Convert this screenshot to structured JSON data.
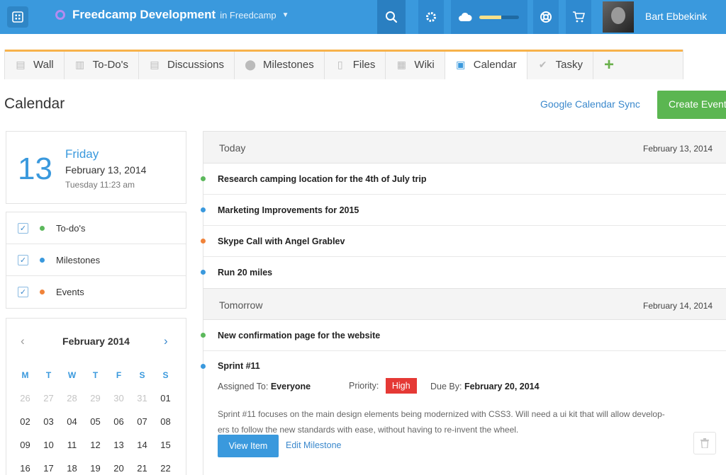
{
  "header": {
    "project_name": "Freedcamp Development",
    "project_sub": "in Freedcamp",
    "user_name": "Bart Ebbekink",
    "storage_fraction": 0.55
  },
  "tabs": [
    {
      "label": "Wall",
      "icon": "wall-icon"
    },
    {
      "label": "To-Do's",
      "icon": "todo-icon"
    },
    {
      "label": "Discussions",
      "icon": "discussions-icon"
    },
    {
      "label": "Milestones",
      "icon": "milestones-icon"
    },
    {
      "label": "Files",
      "icon": "file-icon"
    },
    {
      "label": "Wiki",
      "icon": "wiki-icon"
    },
    {
      "label": "Calendar",
      "icon": "calendar-icon",
      "active": true
    },
    {
      "label": "Tasky",
      "icon": "check-icon"
    },
    {
      "label": "+",
      "icon": "plus-icon"
    }
  ],
  "page": {
    "title": "Calendar",
    "gcal_sync": "Google Calendar Sync",
    "create_event": "Create Event"
  },
  "date_card": {
    "day": "13",
    "weekday": "Friday",
    "full_date": "February 13, 2014",
    "now": "Tuesday 11:23 am"
  },
  "filters": [
    {
      "label": "To-do's",
      "color": "#5cb85c"
    },
    {
      "label": "Milestones",
      "color": "#3a99dd"
    },
    {
      "label": "Events",
      "color": "#f0833a"
    }
  ],
  "mini_calendar": {
    "month": "February 2014",
    "weekdays": [
      "M",
      "T",
      "W",
      "T",
      "F",
      "S",
      "S"
    ],
    "weeks": [
      [
        [
          "26",
          true
        ],
        [
          "27",
          true
        ],
        [
          "28",
          true
        ],
        [
          "29",
          true
        ],
        [
          "30",
          true
        ],
        [
          "31",
          true
        ],
        [
          "01",
          false
        ]
      ],
      [
        [
          "02",
          false
        ],
        [
          "03",
          false
        ],
        [
          "04",
          false
        ],
        [
          "05",
          false
        ],
        [
          "06",
          false
        ],
        [
          "07",
          false
        ],
        [
          "08",
          false
        ]
      ],
      [
        [
          "09",
          false
        ],
        [
          "10",
          false
        ],
        [
          "11",
          false
        ],
        [
          "12",
          false
        ],
        [
          "13",
          false
        ],
        [
          "14",
          false
        ],
        [
          "15",
          false
        ]
      ],
      [
        [
          "16",
          false
        ],
        [
          "17",
          false
        ],
        [
          "18",
          false
        ],
        [
          "19",
          false
        ],
        [
          "20",
          false
        ],
        [
          "21",
          false
        ],
        [
          "22",
          false
        ]
      ]
    ]
  },
  "agenda": {
    "today": {
      "label": "Today",
      "date": "February 13, 2014",
      "items": [
        {
          "title": "Research camping location for the 4th of July trip",
          "color": "#5cb85c"
        },
        {
          "title": "Marketing Improvements for 2015",
          "color": "#3a99dd"
        },
        {
          "title": "Skype Call with Angel Grablev",
          "color": "#f0833a"
        },
        {
          "title": "Run 20 miles",
          "color": "#3a99dd"
        }
      ]
    },
    "tomorrow": {
      "label": "Tomorrow",
      "date": "February 14, 2014",
      "items": [
        {
          "title": "New confirmation page for the website",
          "color": "#5cb85c"
        }
      ]
    },
    "sprint": {
      "title": "Sprint #11",
      "color": "#3a99dd",
      "assigned_label": "Assigned To:",
      "assigned_value": "Everyone",
      "priority_label": "Priority:",
      "priority_value": "High",
      "due_label": "Due By:",
      "due_value": "February 20, 2014",
      "description_line1": "Sprint #11 focuses on the main design elements being modernized with CSS3. Will need a ui kit that will allow develop-",
      "description_line2": "ers to follow the new standards with ease, without having to re-invent the wheel.",
      "view_button": "View Item",
      "edit_link": "Edit Milestone"
    }
  }
}
